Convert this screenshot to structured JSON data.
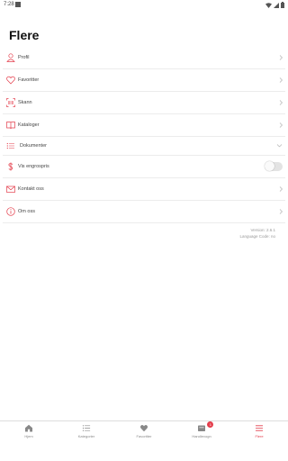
{
  "status_bar": {
    "time": "7:28"
  },
  "page": {
    "title": "Flere"
  },
  "menu": {
    "items": [
      {
        "label": "Profil",
        "icon": "user-icon"
      },
      {
        "label": "Favoritter",
        "icon": "heart-icon"
      },
      {
        "label": "Skann",
        "icon": "barcode-scan-icon"
      },
      {
        "label": "Kataloger",
        "icon": "book-icon"
      },
      {
        "label": "Dokumenter",
        "icon": "list-icon"
      },
      {
        "label": "Vis engrospris",
        "icon": "dollar-icon"
      },
      {
        "label": "Kontakt oss",
        "icon": "mail-icon"
      },
      {
        "label": "Om oss",
        "icon": "info-icon"
      }
    ],
    "toggle_on": false
  },
  "version": {
    "version_text": "Version: 2.6.1",
    "language_text": "Language Code: no"
  },
  "tabbar": {
    "tabs": [
      {
        "label": "Hjem",
        "icon": "home-icon"
      },
      {
        "label": "Kategorier",
        "icon": "list-icon"
      },
      {
        "label": "Favoritter",
        "icon": "heart-icon"
      },
      {
        "label": "Handlevogn",
        "icon": "cart-icon",
        "badge": "1"
      },
      {
        "label": "Flere",
        "icon": "menu-icon",
        "active": true
      }
    ]
  },
  "colors": {
    "accent": "#e43e4c",
    "text": "#444444",
    "muted": "#999999"
  }
}
